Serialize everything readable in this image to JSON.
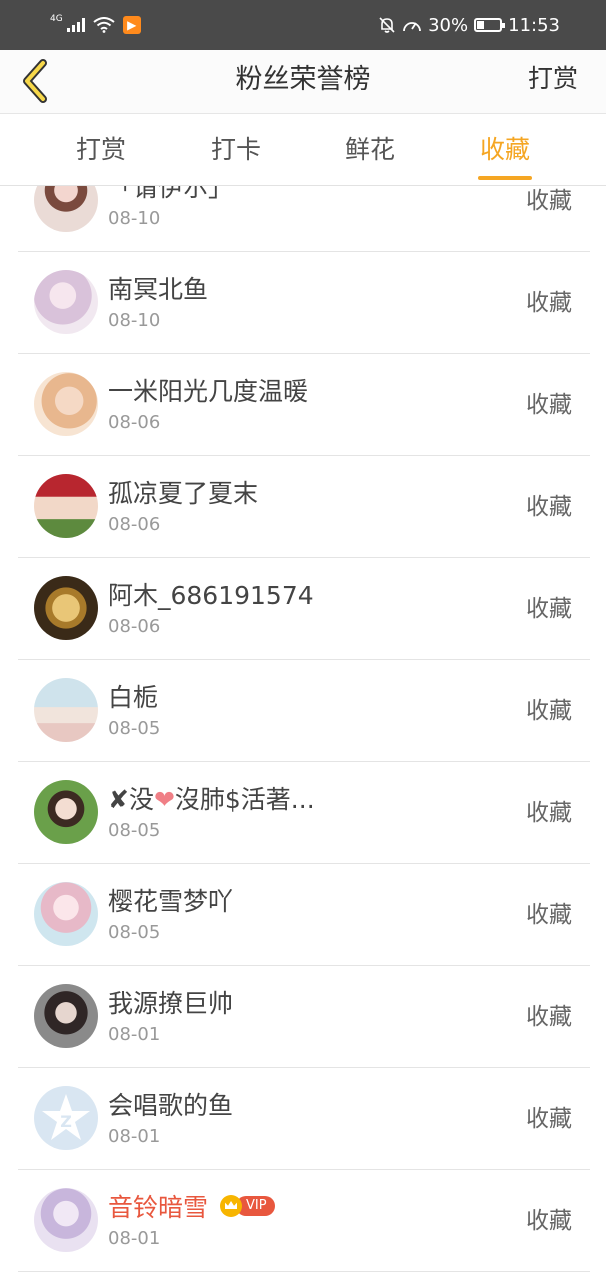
{
  "status_bar": {
    "network": "4G",
    "battery": "30%",
    "time": "11:53",
    "battery_level": 0.3
  },
  "header": {
    "title": "粉丝荣誉榜",
    "action": "打赏"
  },
  "tabs": [
    {
      "label": "打赏",
      "active": false
    },
    {
      "label": "打卡",
      "active": false
    },
    {
      "label": "鲜花",
      "active": false
    },
    {
      "label": "收藏",
      "active": true
    }
  ],
  "list": {
    "items": [
      {
        "name": "「请伊尔」",
        "date": "08-10",
        "action": "收藏"
      },
      {
        "name": "南冥北鱼",
        "date": "08-10",
        "action": "收藏"
      },
      {
        "name": "一米阳光几度温暖",
        "date": "08-06",
        "action": "收藏"
      },
      {
        "name": "孤凉夏了夏末",
        "date": "08-06",
        "action": "收藏"
      },
      {
        "name": "阿木_686191574",
        "date": "08-06",
        "action": "收藏"
      },
      {
        "name": "白栀",
        "date": "08-05",
        "action": "收藏"
      },
      {
        "name_prefix": "✘没",
        "name_suffix": "沒肺$活著...",
        "date": "08-05",
        "action": "收藏"
      },
      {
        "name": "樱花雪梦吖",
        "date": "08-05",
        "action": "收藏"
      },
      {
        "name": "我源撩巨帅",
        "date": "08-01",
        "action": "收藏"
      },
      {
        "name": "会唱歌的鱼",
        "date": "08-01",
        "action": "收藏"
      },
      {
        "name": "音铃暗雪",
        "date": "08-01",
        "action": "收藏",
        "vip_label": "VIP"
      }
    ]
  },
  "colors": {
    "accent": "#f5a623",
    "vip_name": "#e8573e"
  }
}
